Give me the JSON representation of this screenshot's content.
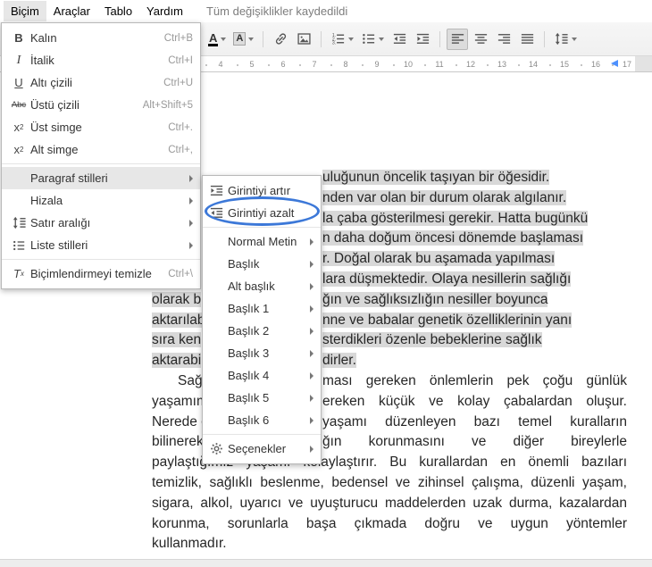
{
  "menubar": {
    "items": [
      {
        "label": "Biçim",
        "active": true
      },
      {
        "label": "Araçlar",
        "active": false
      },
      {
        "label": "Tablo",
        "active": false
      },
      {
        "label": "Yardım",
        "active": false
      }
    ],
    "status": "Tüm değişiklikler kaydedildi"
  },
  "toolbar": {
    "buttons": [
      {
        "name": "text-color-button",
        "icon": "text-color-icon",
        "dropdown": true
      },
      {
        "name": "highlight-color-button",
        "icon": "highlight-color-icon",
        "dropdown": true
      },
      {
        "separator": true
      },
      {
        "name": "insert-link-button",
        "icon": "insert-link-icon"
      },
      {
        "name": "insert-image-button",
        "icon": "insert-image-icon"
      },
      {
        "separator": true
      },
      {
        "name": "numbered-list-button",
        "icon": "numbered-list-icon",
        "dropdown": true
      },
      {
        "name": "bulleted-list-button",
        "icon": "bulleted-list-icon",
        "dropdown": true
      },
      {
        "name": "decrease-indent-button",
        "icon": "decrease-indent-icon"
      },
      {
        "name": "increase-indent-button",
        "icon": "increase-indent-icon"
      },
      {
        "separator": true
      },
      {
        "name": "align-left-button",
        "icon": "align-left-icon",
        "pressed": true
      },
      {
        "name": "align-center-button",
        "icon": "align-center-icon"
      },
      {
        "name": "align-right-button",
        "icon": "align-right-icon"
      },
      {
        "name": "align-justify-button",
        "icon": "align-justify-icon"
      },
      {
        "separator": true
      },
      {
        "name": "line-spacing-button",
        "icon": "line-spacing-icon",
        "dropdown": true
      }
    ]
  },
  "ruler": {
    "unit_numbers": [
      "4",
      "5",
      "6",
      "7",
      "8",
      "9",
      "10",
      "11",
      "12",
      "13",
      "14",
      "15",
      "16",
      "17"
    ]
  },
  "format_menu": {
    "items": [
      {
        "icon": "bold-icon",
        "icon_text": "B",
        "label": "Kalın",
        "shortcut": "Ctrl+B"
      },
      {
        "icon": "italic-icon",
        "icon_text": "I",
        "label": "İtalik",
        "shortcut": "Ctrl+I"
      },
      {
        "icon": "underline-icon",
        "icon_text": "U",
        "label": "Altı çizili",
        "shortcut": "Ctrl+U"
      },
      {
        "icon": "strikethrough-icon",
        "icon_text": "Abc",
        "label": "Üstü çizili",
        "shortcut": "Alt+Shift+5"
      },
      {
        "icon": "superscript-icon",
        "icon_text": "x",
        "icon_sup": "2",
        "label": "Üst simge",
        "shortcut": "Ctrl+."
      },
      {
        "icon": "subscript-icon",
        "icon_text": "x",
        "icon_sub": "2",
        "label": "Alt simge",
        "shortcut": "Ctrl+,"
      },
      {
        "separator": true
      },
      {
        "label": "Paragraf stilleri",
        "submenu": true,
        "highlighted": true
      },
      {
        "label": "Hizala",
        "submenu": true
      },
      {
        "icon": "line-spacing-icon",
        "label": "Satır aralığı",
        "submenu": true
      },
      {
        "icon": "list-styles-icon",
        "label": "Liste stilleri",
        "submenu": true
      },
      {
        "separator": true
      },
      {
        "icon": "clear-formatting-icon",
        "icon_text": "T",
        "icon_sub": "x",
        "label": "Biçimlendirmeyi temizle",
        "shortcut": "Ctrl+\\"
      }
    ]
  },
  "paragraph_styles_submenu": {
    "items": [
      {
        "icon": "increase-indent-icon",
        "label": "Girintiyi artır"
      },
      {
        "icon": "decrease-indent-icon",
        "label": "Girintiyi azalt",
        "annotated": true
      },
      {
        "separator": true
      },
      {
        "label": "Normal Metin",
        "submenu": true
      },
      {
        "label": "Başlık",
        "submenu": true
      },
      {
        "label": "Alt başlık",
        "submenu": true
      },
      {
        "label": "Başlık 1",
        "submenu": true
      },
      {
        "label": "Başlık 2",
        "submenu": true
      },
      {
        "label": "Başlık 3",
        "submenu": true
      },
      {
        "label": "Başlık 4",
        "submenu": true
      },
      {
        "label": "Başlık 5",
        "submenu": true
      },
      {
        "label": "Başlık 6",
        "submenu": true
      },
      {
        "separator": true
      },
      {
        "icon": "gear-icon",
        "label": "Seçenekler",
        "submenu": true
      }
    ]
  },
  "document": {
    "lines": [
      {
        "right": "uluğunun öncelik taşıyan bir öğesidir.",
        "selected": true
      },
      {
        "right": "nden var olan bir durum olarak algılanır.",
        "selected": true
      },
      {
        "right": "la çaba gösterilmesi gerekir. Hatta bugünkü",
        "selected": true
      },
      {
        "right": "n daha doğum öncesi dönemde başlaması",
        "selected": true
      },
      {
        "right": "r. Doğal olarak bu aşamada yapılması",
        "selected": true
      },
      {
        "right": "lara düşmektedir. Olaya nesillerin sağlığı",
        "selected": true
      },
      {
        "left": "olarak b",
        "right": "ğın ve sağlıksızlığın nesiller boyunca",
        "selected": true
      },
      {
        "left": "aktarılab",
        "right": "nne ve babalar genetik özelliklerinin yanı",
        "selected": true
      },
      {
        "left": "sıra ken",
        "right": "sterdikleri özenle bebeklerine sağlık",
        "selected": true
      },
      {
        "left": "aktarabi",
        "right": "dirler.",
        "selected": true
      },
      {
        "left": "Sağlıklı bi",
        "right": "ması gereken önlemlerin pek çoğu günlük",
        "indent": true,
        "justify_right": true
      },
      {
        "left": "yaşamımızda",
        "right": "ereken küçük ve kolay çabalardan oluşur.",
        "justify_right": true
      },
      {
        "left": "Nerede olurs",
        "right": "yaşamı düzenleyen bazı temel kuralların",
        "justify_right": true
      },
      {
        "left": "bilinerek uy",
        "right": "ğın korunmasını ve diğer bireylerle",
        "justify_right": true
      },
      {
        "full": "paylaştığımız yaşamı kolaylaştırır. Bu kurallardan en önemli bazıları",
        "justify": true
      },
      {
        "full": "temizlik, sağlıklı beslenme, bedensel ve zihinsel çalışma, düzenli yaşam,",
        "justify": true
      },
      {
        "full": "sigara, alkol, uyarıcı ve uyuşturucu maddelerden uzak durma, kazalardan",
        "justify": true
      },
      {
        "full": "korunma, sorunlarla başa çıkmada doğru ve uygun yöntemler",
        "justify": true
      },
      {
        "full": "kullanmadır."
      }
    ]
  },
  "colors": {
    "selection": "#d8d8d8",
    "annotation": "#3c78d8",
    "ruler_marker": "#4d90fe"
  }
}
